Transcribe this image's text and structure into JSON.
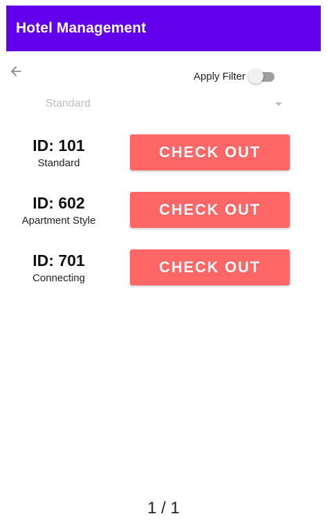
{
  "app": {
    "title": "Hotel Management"
  },
  "toolbar": {
    "back_icon": "arrow-left-icon",
    "filter_label": "Apply Filter",
    "filter_enabled": false
  },
  "spinner": {
    "selected": "Standard"
  },
  "rooms": [
    {
      "id_label": "ID: 101",
      "type": "Standard",
      "button_label": "CHECK OUT"
    },
    {
      "id_label": "ID: 602",
      "type": "Apartment Style",
      "button_label": "CHECK OUT"
    },
    {
      "id_label": "ID: 701",
      "type": "Connecting",
      "button_label": "CHECK OUT"
    }
  ],
  "pagination": {
    "text": "1 / 1"
  },
  "colors": {
    "app_bar": "#6200ee",
    "checkout_button": "#ff6666",
    "spinner_text": "#bdbdbd",
    "switch_track_off": "#9e9e9e"
  }
}
